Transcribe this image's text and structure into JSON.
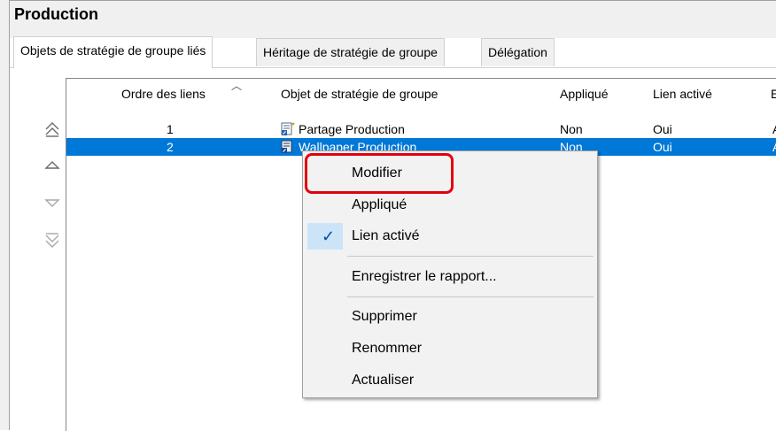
{
  "title": "Production",
  "tabs": [
    {
      "label": "Objets de stratégie de groupe liés"
    },
    {
      "label": "Héritage de stratégie de groupe"
    },
    {
      "label": "Délégation"
    }
  ],
  "table": {
    "columns": [
      "Ordre des liens",
      "Objet de stratégie de groupe",
      "Appliqué",
      "Lien activé",
      "E"
    ],
    "rows": [
      {
        "order": "1",
        "gpo": "Partage Production",
        "applied": "Non",
        "enabled": "Oui",
        "status": "A"
      },
      {
        "order": "2",
        "gpo": "Wallpaper Production",
        "applied": "Non",
        "enabled": "Oui",
        "status": "A"
      }
    ],
    "selected_row": 2
  },
  "order_buttons": {
    "move_top": "move-to-top-icon",
    "move_up": "move-up-icon",
    "move_down": "move-down-icon",
    "move_bottom": "move-to-bottom-icon"
  },
  "context_menu": {
    "modifier": "Modifier",
    "applique": "Appliqué",
    "lien_active": "Lien activé",
    "enregistrer": "Enregistrer le rapport...",
    "supprimer": "Supprimer",
    "renommer": "Renommer",
    "actualiser": "Actualiser"
  },
  "colors": {
    "selection": "#0078d7",
    "highlight_box": "#e3000f",
    "check_bg": "#cce4f7"
  }
}
